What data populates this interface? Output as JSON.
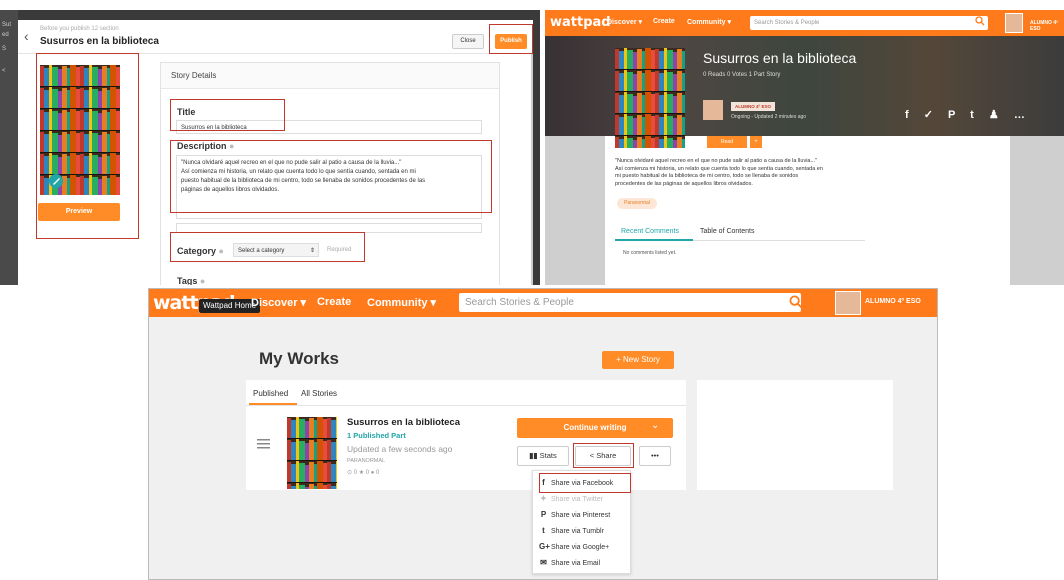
{
  "colors": {
    "brand": "#ff7a1a",
    "button": "#ff8c26",
    "teal": "#20a5a8",
    "highlight": "#c0392b"
  },
  "editor": {
    "sidebar_letters": [
      "Sut",
      "ed",
      "S",
      "<"
    ],
    "back_icon": "chevron-left-icon",
    "subtitle": "Before you publish 12 section",
    "title": "Susurros en la biblioteca",
    "close_label": "Close",
    "publish_label": "Publish",
    "preview_label": "Preview",
    "details_header": "Story Details",
    "title_label": "Title",
    "title_value": "Susurros en la biblioteca",
    "description_label": "Description",
    "description_lines": [
      "\"Nunca olvidaré aquel recreo en el que no pude salir al patio a causa de la lluvia...\"",
      "Así comienza mi historia, un relato que cuenta todo lo que sentía cuando, sentada en mi",
      "puesto habitual de la biblioteca de mi centro, todo se llenaba de sonidos procedentes de las",
      "páginas de aquellos libros olvidados."
    ],
    "category_label": "Category",
    "category_value": "Select a category",
    "required_label": "Required",
    "tags_label": "Tags"
  },
  "story_page": {
    "logo": "wattpad",
    "nav": [
      "Discover",
      "Create",
      "Community"
    ],
    "search_placeholder": "Search Stories & People",
    "user": "ALUMNO 4º ESO",
    "story_title": "Susurros en la biblioteca",
    "meta": "0 Reads   0 Votes   1 Part Story",
    "author_badge": "ALUMNO 4º ESO",
    "status": "Ongoing - Updated 2 minutes ago",
    "read_label": "Read",
    "plus_label": "+",
    "social": "f  ✓  P  t  ♟  …",
    "description_lines": [
      "\"Nunca olvidaré aquel recreo en el que no pude salir al patio a causa de la lluvia...\"",
      "Así comienza mi historia, un relato que cuenta todo lo que sentía cuando, sentada en",
      "mi puesto habitual de la biblioteca de mi centro, todo se llenaba de sonidos",
      "procedentes de las páginas de aquellos libros olvidados."
    ],
    "genre": "Paranormal",
    "tab_comments": "Recent Comments",
    "tab_toc": "Table of Contents",
    "no_comments": "No comments listed yet."
  },
  "my_works": {
    "logo": "wattpad",
    "tooltip": "Wattpad Home",
    "nav": [
      "Discover",
      "Create",
      "Community"
    ],
    "search_placeholder": "Search Stories & People",
    "user": "ALUMNO 4º ESO",
    "page_title": "My Works",
    "new_story_label": "+ New Story",
    "tab_published": "Published",
    "tab_all": "All Stories",
    "story_title": "Susurros en la biblioteca",
    "parts": "1 Published Part",
    "updated": "Updated a few seconds ago",
    "genre": "PARANORMAL",
    "stats_line": "⊙ 0   ★ 0   ● 0",
    "continue_label": "Continue writing",
    "stats_label": "Stats",
    "share_label": "Share",
    "more_label": "•••",
    "share_menu": [
      {
        "icon": "facebook-icon",
        "glyph": "f",
        "label": "Share via Facebook"
      },
      {
        "icon": "twitter-icon",
        "glyph": "✦",
        "label": "Share via Twitter"
      },
      {
        "icon": "pinterest-icon",
        "glyph": "P",
        "label": "Share via Pinterest"
      },
      {
        "icon": "tumblr-icon",
        "glyph": "t",
        "label": "Share via Tumblr"
      },
      {
        "icon": "google-plus-icon",
        "glyph": "G+",
        "label": "Share via Google+"
      },
      {
        "icon": "email-icon",
        "glyph": "✉",
        "label": "Share via Email"
      }
    ]
  }
}
